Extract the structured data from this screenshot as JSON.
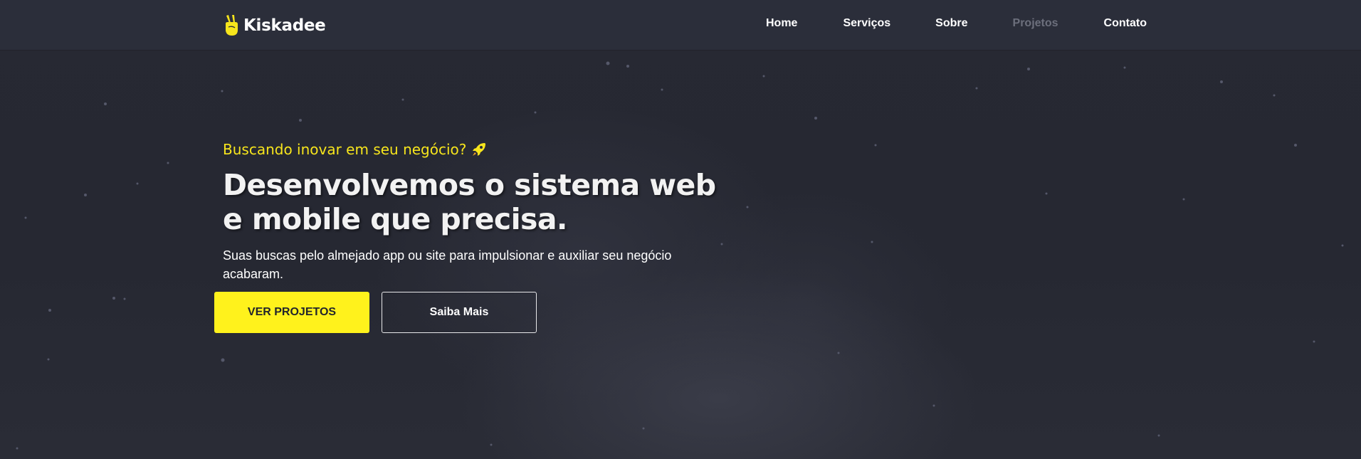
{
  "brand": {
    "name": "Kiskadee",
    "icon": "victory-hand-icon"
  },
  "nav": {
    "items": [
      {
        "label": "Home",
        "active": false
      },
      {
        "label": "Serviços",
        "active": false
      },
      {
        "label": "Sobre",
        "active": false
      },
      {
        "label": "Projetos",
        "active": true
      },
      {
        "label": "Contato",
        "active": false
      }
    ]
  },
  "hero": {
    "eyebrow": "Buscando inovar em seu negócio?",
    "eyebrow_icon": "rocket-icon",
    "headline": "Desenvolvemos o sistema web e mobile que precisa.",
    "subtext": "Suas buscas pelo almejado app ou site para impulsionar e auxiliar seu negócio acabaram.",
    "primary_button": "VER PROJETOS",
    "secondary_button": "Saiba Mais"
  },
  "colors": {
    "accent": "#fff21c",
    "header_bg": "#2b2e3a",
    "page_bg": "#262832",
    "nav_active": "#6c6f7c"
  }
}
